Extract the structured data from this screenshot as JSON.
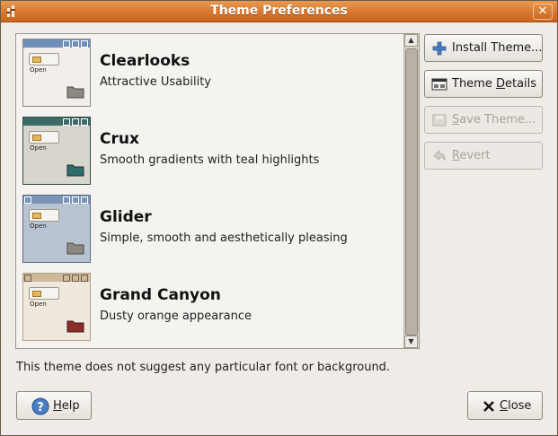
{
  "window": {
    "title": "Theme Preferences"
  },
  "themes": [
    {
      "name": "Clearlooks",
      "description": "Attractive Usability",
      "thumb_open_label": "Open"
    },
    {
      "name": "Crux",
      "description": "Smooth gradients with teal highlights",
      "thumb_open_label": "Open"
    },
    {
      "name": "Glider",
      "description": "Simple, smooth and aesthetically pleasing",
      "thumb_open_label": "Open"
    },
    {
      "name": "Grand Canyon",
      "description": "Dusty orange appearance",
      "thumb_open_label": "Open"
    }
  ],
  "sidebar": {
    "install": {
      "label_pre": "Install Theme...",
      "enabled": true,
      "icon": "plus-icon"
    },
    "details": {
      "label_pre": "Theme ",
      "label_ul": "D",
      "label_post": "etails",
      "enabled": true,
      "icon": "theme-details-icon"
    },
    "save": {
      "label_ul": "S",
      "label_post": "ave Theme...",
      "enabled": false,
      "icon": "save-icon"
    },
    "revert": {
      "label_ul": "R",
      "label_post": "evert",
      "enabled": false,
      "icon": "revert-icon"
    }
  },
  "info_text": "This theme does not suggest any particular font or background.",
  "footer": {
    "help": {
      "label_ul": "H",
      "label_post": "elp",
      "icon": "help-icon"
    },
    "close": {
      "label_ul": "C",
      "label_post": "lose",
      "icon": "close-x-icon"
    }
  },
  "colors": {
    "titlebar": "#d8772f",
    "clearlooks_bar": "#6d8fb8",
    "crux_bar": "#3e6b68",
    "glider_bar": "#7b93b5",
    "canyon_bar": "#cfb99b"
  }
}
